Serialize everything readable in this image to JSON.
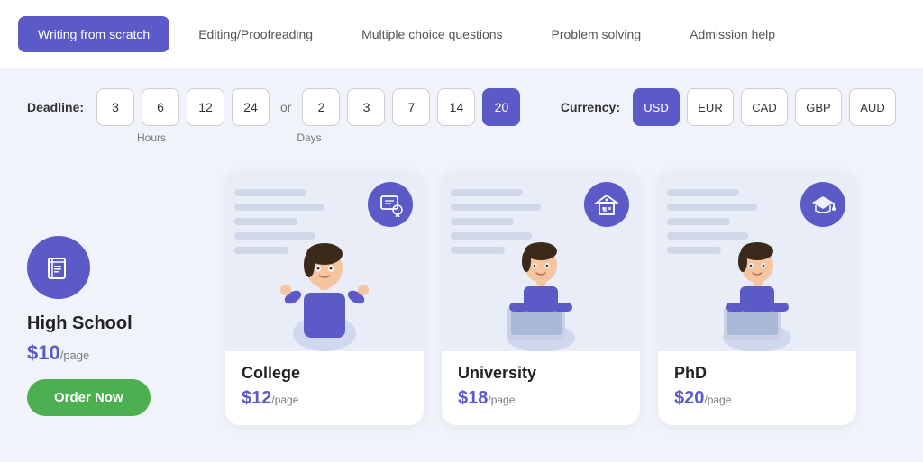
{
  "nav": {
    "items": [
      {
        "id": "writing",
        "label": "Writing from scratch",
        "active": true
      },
      {
        "id": "editing",
        "label": "Editing/Proofreading",
        "active": false
      },
      {
        "id": "mcq",
        "label": "Multiple choice questions",
        "active": false
      },
      {
        "id": "problem",
        "label": "Problem solving",
        "active": false
      },
      {
        "id": "admission",
        "label": "Admission help",
        "active": false
      }
    ]
  },
  "deadline": {
    "label": "Deadline:",
    "hours": [
      {
        "value": "3",
        "active": false
      },
      {
        "value": "6",
        "active": false
      },
      {
        "value": "12",
        "active": false
      },
      {
        "value": "24",
        "active": false
      }
    ],
    "or_label": "or",
    "days": [
      {
        "value": "2",
        "active": false
      },
      {
        "value": "3",
        "active": false
      },
      {
        "value": "7",
        "active": false
      },
      {
        "value": "14",
        "active": false
      },
      {
        "value": "20",
        "active": true
      }
    ],
    "hours_label": "Hours",
    "days_label": "Days"
  },
  "currency": {
    "label": "Currency:",
    "options": [
      {
        "value": "USD",
        "active": true
      },
      {
        "value": "EUR",
        "active": false
      },
      {
        "value": "CAD",
        "active": false
      },
      {
        "value": "GBP",
        "active": false
      },
      {
        "value": "AUD",
        "active": false
      }
    ]
  },
  "cards": [
    {
      "id": "high-school",
      "type": "flat",
      "icon": "book",
      "title": "High School",
      "price": "$10",
      "per_page": "/page",
      "order_label": "Order Now"
    },
    {
      "id": "college",
      "type": "image",
      "icon": "cert",
      "title": "College",
      "price": "$12",
      "per_page": "/page"
    },
    {
      "id": "university",
      "type": "image",
      "icon": "university",
      "title": "University",
      "price": "$18",
      "per_page": "/page"
    },
    {
      "id": "phd",
      "type": "image",
      "icon": "phd",
      "title": "PhD",
      "price": "$20",
      "per_page": "/page"
    }
  ],
  "colors": {
    "accent": "#5c5ac6",
    "green": "#4caf50",
    "bg": "#f0f4fa"
  }
}
